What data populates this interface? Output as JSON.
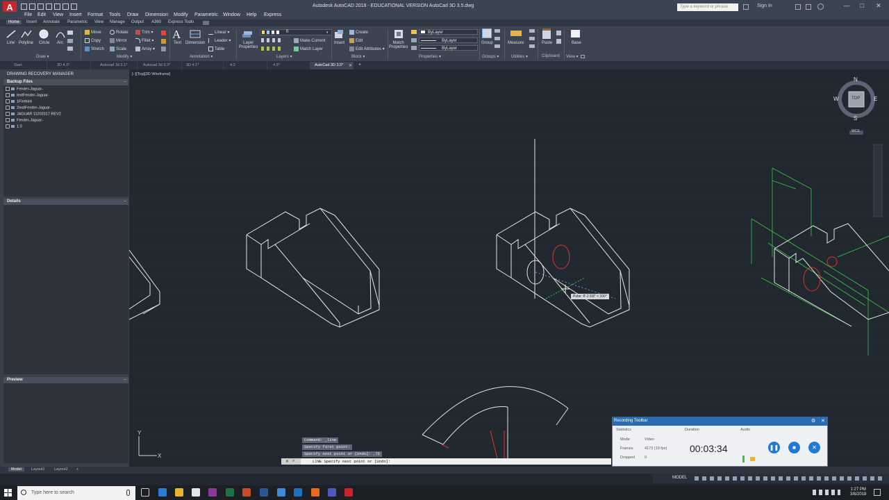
{
  "window": {
    "title": "Autodesk AutoCAD 2018 - EDUCATIONAL VERSION    AutoCad 3D 3.5.dwg",
    "app_logo": "A",
    "search_placeholder": "Type a keyword or phrase",
    "sign_in": "Sign In",
    "controls": [
      "—",
      "□",
      "✕"
    ]
  },
  "menu": [
    "File",
    "Edit",
    "View",
    "Insert",
    "Format",
    "Tools",
    "Draw",
    "Dimension",
    "Modify",
    "Parametric",
    "Window",
    "Help",
    "Express"
  ],
  "ribbon_tabs": [
    "Home",
    "Insert",
    "Annotate",
    "Parametric",
    "View",
    "Manage",
    "Output",
    "A360",
    "Express Tools"
  ],
  "ribbon": {
    "draw": {
      "line": "Line",
      "polyline": "Polyline",
      "circle": "Circle",
      "arc": "Arc",
      "panel": "Draw ▾"
    },
    "modify": {
      "move": "Move",
      "rotate": "Rotate",
      "trim": "Trim ▾",
      "copy": "Copy",
      "mirror": "Mirror",
      "fillet": "Fillet ▾",
      "stretch": "Stretch",
      "scale": "Scale",
      "array": "Array ▾",
      "panel": "Modify ▾"
    },
    "annotation": {
      "text": "Text",
      "dimension": "Dimension",
      "linear": "Linear ▾",
      "leader": "Leader ▾",
      "table": "Table",
      "panel": "Annotation ▾"
    },
    "layers": {
      "layer_properties": "Layer\nProperties",
      "layer_value": "0",
      "make_current": "Make Current",
      "match_layer": "Match Layer",
      "panel": "Layers ▾"
    },
    "block": {
      "insert": "Insert",
      "create": "Create",
      "edit": "Edit",
      "edit_attributes": "Edit Attributes ▾",
      "panel": "Block ▾"
    },
    "properties": {
      "match": "Match\nProperties",
      "color": "ByLayer",
      "linetype": "ByLayer",
      "lineweight": "ByLayer",
      "panel": "Properties ▾"
    },
    "groups": {
      "group": "Group",
      "panel": "Groups ▾"
    },
    "utilities": {
      "measure": "Measure",
      "panel": "Utilities ▾"
    },
    "clipboard": {
      "paste": "Paste",
      "panel": "Clipboard"
    },
    "view": {
      "base": "Base",
      "panel": "View ▾"
    }
  },
  "file_tabs": [
    "Start",
    "3D 4.3*",
    "Autocad 3d 3.1*",
    "Autocad 3d 3.3*",
    "3D 4.1*",
    "4.2",
    "4.5*",
    "AutoCad 3D 3.5*"
  ],
  "palette": {
    "title": "DRAWING RECOVERY MANAGER",
    "backup_header": "Backup Files",
    "backup_files": [
      "Fender-Jaguar-",
      "testFender-Jaguar-",
      "1Firebird",
      "2testFender-Jaguar-",
      "JAGUAR 11202017 REV2",
      "Fender-Jaguar-",
      "1.0"
    ],
    "details_header": "Details",
    "preview_header": "Preview"
  },
  "viewport": {
    "label": "[−][Top][3D Wireframe]",
    "viewcube": {
      "n": "N",
      "s": "S",
      "e": "E",
      "w": "W",
      "face": "TOP",
      "wcs": "WCS"
    },
    "tooltip": "Polar: 8'-2 5/8\" < 330°"
  },
  "command": {
    "history": [
      "Command: _line",
      "Specify first point:",
      "Specify next point or [Undo]: .75"
    ],
    "prompt": "LINE Specify next point or [Undo]:"
  },
  "recorder": {
    "title": "Recording Toolbar",
    "statistics_label": "Statistics",
    "mode_label": "Mode",
    "mode_value": "Video",
    "frames_label": "Frames",
    "frames_value": "4173 (19 fps)",
    "dropped_label": "Dropped",
    "dropped_value": "0",
    "duration_label": "Duration",
    "duration_value": "00:03:34",
    "audio_label": "Audio"
  },
  "layout_tabs": [
    "Model",
    "Layout1",
    "Layout2",
    "+"
  ],
  "status": {
    "model": "MODEL"
  },
  "taskbar": {
    "search": "Type here to search",
    "time": "1:27 PM",
    "date": "3/8/2018"
  },
  "colors": {
    "accent": "#2b6cb0",
    "canvas": "#212830",
    "wire": "#e6e6e6",
    "green": "#38c84a",
    "red": "#e03030"
  }
}
